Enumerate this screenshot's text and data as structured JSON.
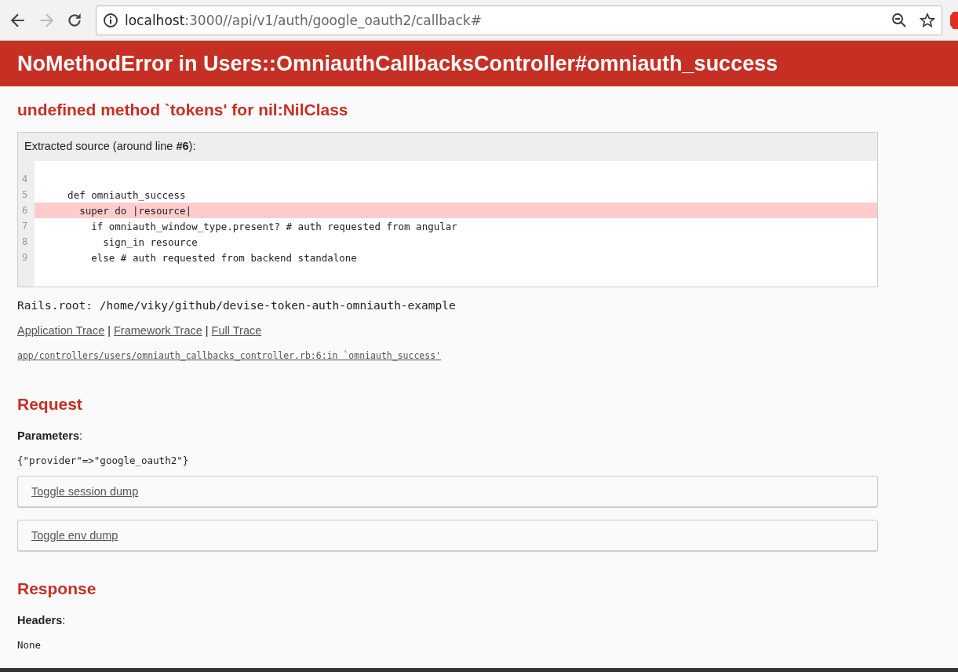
{
  "browser": {
    "url_host": "localhost",
    "url_path": ":3000//api/v1/auth/google_oauth2/callback#",
    "back_disabled": false,
    "forward_disabled": true
  },
  "header": {
    "title": "NoMethodError in Users::OmniauthCallbacksController#omniauth_success"
  },
  "error_message": "undefined method `tokens' for nil:NilClass",
  "source": {
    "caption": "Extracted source (around line **#6**):",
    "lines": [
      {
        "number": "4",
        "selected": false
      },
      {
        "number": "5",
        "code": "    def omniauth_success",
        "selected": false
      },
      {
        "number": "6",
        "code": "      super do |resource|",
        "selected": true
      },
      {
        "number": "7",
        "code": "        if omniauth_window_type.present? # auth requested from angular",
        "selected": false
      },
      {
        "number": "8",
        "code": "          sign_in resource",
        "selected": false
      },
      {
        "number": "9",
        "code": "        else # auth requested from backend standalone",
        "selected": false
      }
    ]
  },
  "rails_root": "Rails.root: /home/viky/github/devise-token-auth-omniauth-example",
  "trace_links": [
    {
      "label": "Application Trace"
    },
    {
      "label": "Framework Trace"
    },
    {
      "label": "Full Trace"
    }
  ],
  "trace_separator": "|",
  "trace_line": "app/controllers/users/omniauth_callbacks_controller.rb:6:in `omniauth_success'",
  "request": {
    "heading": "Request",
    "params_label": "**Parameters**:",
    "params": "{\"provider\"=>\"google_oauth2\"}",
    "toggles": [
      {
        "label": "Toggle session dump"
      },
      {
        "label": "Toggle env dump"
      }
    ]
  },
  "response": {
    "heading": "Response",
    "headers_label": "**Headers**:",
    "headers": "None"
  }
}
